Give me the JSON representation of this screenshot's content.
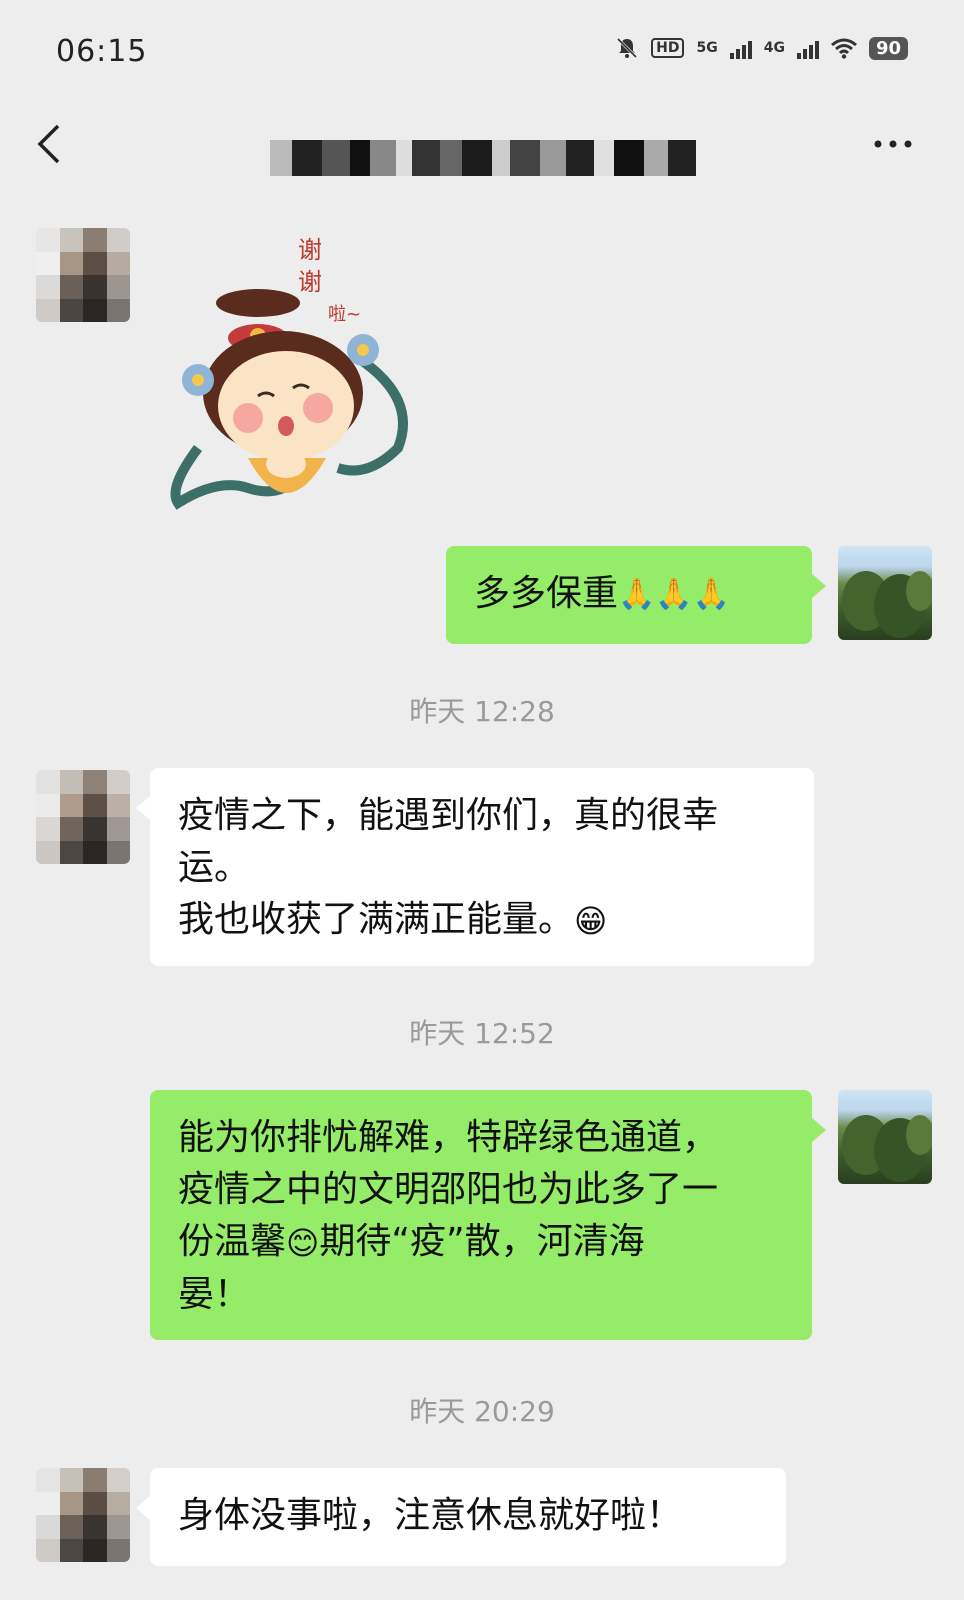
{
  "status": {
    "time": "06:15",
    "hd_label": "HD",
    "net1": "5G",
    "net2": "4G",
    "battery": "90"
  },
  "header": {
    "back_icon": "chevron-left-icon",
    "title": "",
    "more_icon": "more-icon"
  },
  "sticker": {
    "text_lines": [
      "谢",
      "谢",
      "啦~"
    ]
  },
  "messages": [
    {
      "side": "in",
      "text_lines": []
    },
    {
      "side": "out",
      "text_before_emoji": "多多保重",
      "emoji": "🙏🙏🙏"
    },
    {
      "side": "time",
      "text": "昨天 12:28"
    },
    {
      "side": "in",
      "lines": [
        "疫情之下，能遇到你们，真的很幸",
        "运。"
      ],
      "last_line_before_emoji": "我也收获了满满正能量。",
      "emoji": "😁"
    },
    {
      "side": "time",
      "text": "昨天 12:52"
    },
    {
      "side": "out",
      "line1": "能为你排忧解难，特辟绿色通道，",
      "line2": "疫情之中的文明邵阳也为此多了一",
      "line3_before_emoji": "份温馨",
      "emoji": "😊",
      "line3_after_emoji": "期待“疫”散，河清海",
      "line4": "晏！"
    },
    {
      "side": "time",
      "text": "昨天 20:29"
    },
    {
      "side": "in",
      "text": "身体没事啦，注意休息就好啦！"
    }
  ],
  "colors": {
    "background": "#ededed",
    "bubble_out": "#95ec69",
    "bubble_in": "#ffffff",
    "timestamp": "#9a9a9a"
  }
}
